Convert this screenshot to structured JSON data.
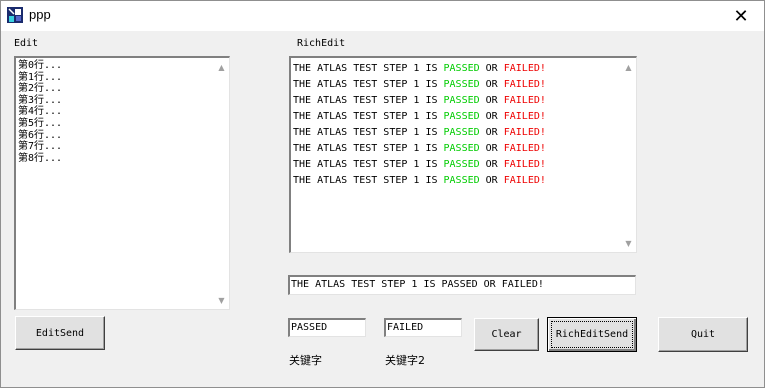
{
  "window": {
    "title": "ppp",
    "close_glyph": "✕"
  },
  "labels": {
    "edit": "Edit",
    "richedit": "RichEdit",
    "keyword1": "关键字",
    "keyword2": "关键字2"
  },
  "edit": {
    "lines": [
      "第0行...",
      "第1行...",
      "第2行...",
      "第3行...",
      "第4行...",
      "第5行...",
      "第6行...",
      "第7行...",
      "第8行..."
    ]
  },
  "richedit": {
    "line_count": 8,
    "segments": [
      {
        "text": "THE ATLAS TEST STEP 1 IS ",
        "color": "#000000"
      },
      {
        "text": "PASSED",
        "color": "#00cc00"
      },
      {
        "text": " OR ",
        "color": "#000000"
      },
      {
        "text": "FAILED!",
        "color": "#ee0000"
      }
    ]
  },
  "input": {
    "value": "THE ATLAS TEST STEP 1 IS PASSED OR FAILED!"
  },
  "keyword_fields": {
    "passed": "PASSED",
    "failed": "FAILED"
  },
  "buttons": {
    "editsend": "EditSend",
    "clear": "Clear",
    "richeditsend": "RichEditSend",
    "quit": "Quit"
  },
  "icons": {
    "app": "app-icon",
    "close": "close-icon",
    "scroll_up": "scroll-up-arrow-icon",
    "scroll_down": "scroll-down-arrow-icon"
  }
}
